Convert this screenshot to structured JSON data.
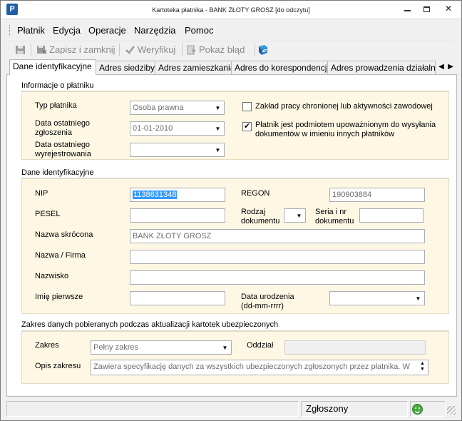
{
  "window": {
    "title": "Kartoteka płatnika  -  BANK ZŁOTY GROSZ [do odczytu]",
    "app_icon_letter": "P"
  },
  "menu": {
    "items": [
      "Płatnik",
      "Edycja",
      "Operacje",
      "Narzędzia",
      "Pomoc"
    ]
  },
  "toolbar": {
    "save_close": "Zapisz i zamknij",
    "verify": "Weryfikuj",
    "show_error": "Pokaż błąd"
  },
  "tabs": [
    "Dane identyfikacyjne",
    "Adres siedziby",
    "Adres zamieszkania",
    "Adres do korespondencji",
    "Adres prowadzenia działalności"
  ],
  "info_section": {
    "title": "Informacje o płatniku",
    "payer_type_label": "Typ płatnika",
    "payer_type_value": "Osoba prawna",
    "last_report_label_1": "Data ostatniego",
    "last_report_label_2": "zgłoszenia",
    "last_report_value": "01-01-2010",
    "last_dereg_label_1": "Data ostatniego",
    "last_dereg_label_2": "wyrejestrowania",
    "last_dereg_value": "",
    "protected_work_label": "Zakład pracy chronionej lub aktywności zawodowej",
    "protected_work_checked": false,
    "authorized_label_1": "Płatnik jest podmiotem upoważnionym do wysyłania",
    "authorized_label_2": "dokumentów w imieniu innych płatników",
    "authorized_checked": true
  },
  "id_section": {
    "title": "Dane identyfikacyjne",
    "nip_label": "NIP",
    "nip_value": "1138631348",
    "regon_label": "REGON",
    "regon_value": "190903884",
    "pesel_label": "PESEL",
    "pesel_value": "",
    "doc_type_label_1": "Rodzaj",
    "doc_type_label_2": "dokumentu",
    "doc_series_label_1": "Seria i nr",
    "doc_series_label_2": "dokumentu",
    "short_name_label": "Nazwa skrócona",
    "short_name_value": "BANK ZŁOTY GROSZ",
    "name_label": "Nazwa / Firma",
    "surname_label": "Nazwisko",
    "first_name_label": "Imię pierwsze",
    "birth_date_label_1": "Data urodzenia",
    "birth_date_label_2": "(dd-mm-rrrr)"
  },
  "scope_section": {
    "title": "Zakres danych pobieranych podczas aktualizacji kartotek ubezpieczonych",
    "scope_label": "Zakres",
    "scope_value": "Pełny zakres",
    "branch_label": "Oddział",
    "branch_value": "",
    "desc_label": "Opis zakresu",
    "desc_value": "Zawiera specyfikację danych za wszystkich ubezpieczonych zgłoszonych przez płatnika. W"
  },
  "statusbar": {
    "status": "Zgłoszony"
  },
  "colors": {
    "section_bg": "#fdf7e4",
    "selection": "#3399ff",
    "status_ok": "#4aa93c"
  }
}
